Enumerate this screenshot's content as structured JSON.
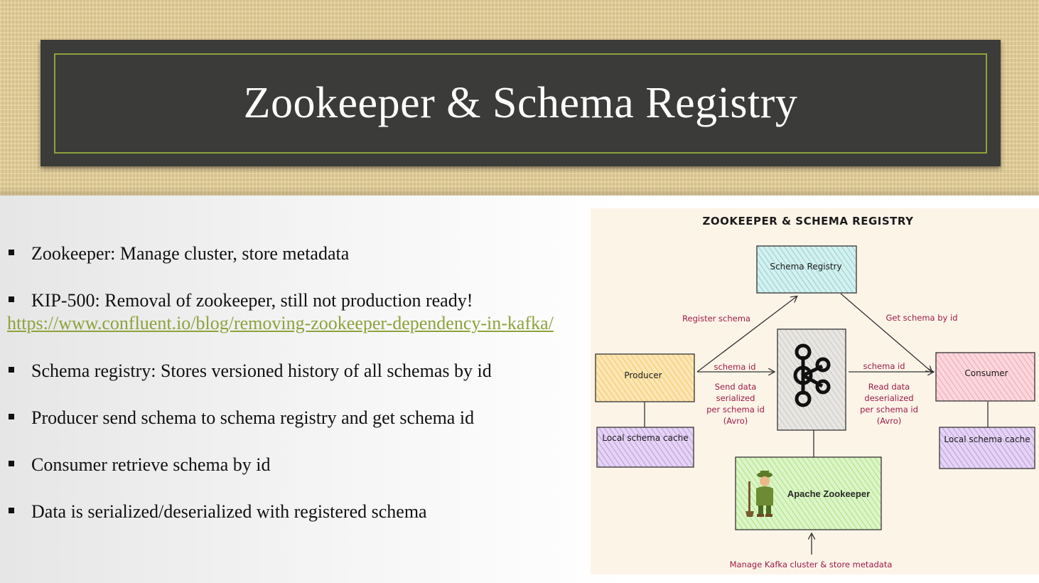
{
  "slide": {
    "title": "Zookeeper & Schema Registry",
    "bullets": [
      "Zookeeper: Manage cluster, store metadata",
      "KIP-500: Removal of zookeeper, still not production ready!",
      "Schema registry: Stores versioned history of all schemas by id",
      "Producer send schema to schema registry and get schema id",
      "Consumer retrieve schema by id",
      "Data is serialized/deserialized with registered schema"
    ],
    "link": "https://www.confluent.io/blog/removing-zookeeper-dependency-in-kafka/"
  },
  "diagram": {
    "title": "ZOOKEEPER & SCHEMA REGISTRY",
    "schema_registry": "Schema Registry",
    "producer": "Producer",
    "consumer": "Consumer",
    "local_cache_left": "Local schema cache",
    "local_cache_right": "Local schema cache",
    "zookeeper": "Apache Zookeeper",
    "register_schema": "Register schema",
    "get_schema": "Get schema by id",
    "schema_id_left": "schema id",
    "schema_id_right": "schema id",
    "send_lines": [
      "Send data",
      "serialized",
      "per schema id",
      "(Avro)"
    ],
    "read_lines": [
      "Read data",
      "deserialized",
      "per schema id",
      "(Avro)"
    ],
    "manage": "Manage Kafka cluster & store metadata",
    "colors": {
      "schema_registry_fill": "#bfe6e6",
      "producer_fill": "#f7d58c",
      "consumer_fill": "#f6b8c0",
      "cache_fill": "#d2b8ea",
      "zookeeper_fill": "#c6eeaa",
      "kafka_fill": "#dcdad6",
      "annotation": "#9b1b48"
    }
  }
}
